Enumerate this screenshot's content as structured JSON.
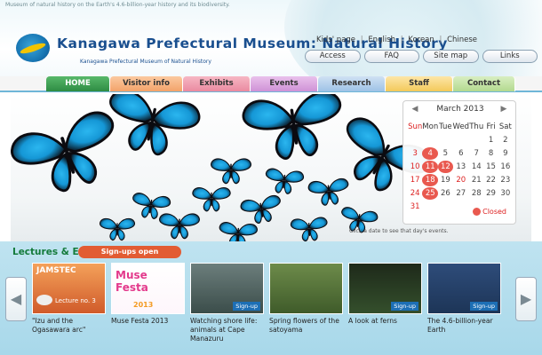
{
  "header": {
    "intro": "Museum of natural history on the Earth's 4.6-billion-year history and its biodiversity.",
    "title": "Kanagawa Prefectural Museum: Natural History",
    "subtitle": "Kanagawa Prefectural Museum of Natural History",
    "top_links": [
      "Kids' page",
      "English",
      "Korean",
      "Chinese"
    ],
    "pills": [
      "Access",
      "FAQ",
      "Site map",
      "Links"
    ]
  },
  "nav": {
    "tabs": [
      "HOME",
      "Visitor info",
      "Exhibits",
      "Events",
      "Research",
      "Staff",
      "Contact"
    ]
  },
  "calendar": {
    "month_label": "March 2013",
    "prev": "◀",
    "next": "▶",
    "weekdays": [
      "Sun",
      "Mon",
      "Tue",
      "Wed",
      "Thu",
      "Fri",
      "Sat"
    ],
    "days": [
      "",
      "",
      "",
      "",
      "",
      "1",
      "2",
      "3",
      "4",
      "5",
      "6",
      "7",
      "8",
      "9",
      "10",
      "11",
      "12",
      "13",
      "14",
      "15",
      "16",
      "17",
      "18",
      "19",
      "20",
      "21",
      "22",
      "23",
      "24",
      "25",
      "26",
      "27",
      "28",
      "29",
      "30",
      "31",
      "",
      "",
      "",
      "",
      "",
      ""
    ],
    "closed_days": [
      "4",
      "11",
      "12",
      "18",
      "25"
    ],
    "legend": "Closed",
    "note": "Click a date to see that day's events."
  },
  "events": {
    "label": "Lectures & Events",
    "badge": "Sign-ups open",
    "arrow_left": "◀",
    "arrow_right": "▶",
    "cards": [
      {
        "thumb_title": "JAMSTEC",
        "thumb_sub": "Lecture no. 3",
        "caption": "\"Izu and the Ogasawara arc\"",
        "stamp": ""
      },
      {
        "thumb_title": "Muse Festa",
        "thumb_sub": "2013",
        "caption": "Muse Festa 2013",
        "stamp": ""
      },
      {
        "thumb_title": "",
        "thumb_sub": "",
        "caption": "Watching shore life: animals at Cape Manazuru",
        "stamp": "Sign-up"
      },
      {
        "thumb_title": "",
        "thumb_sub": "",
        "caption": "Spring flowers of the satoyama",
        "stamp": ""
      },
      {
        "thumb_title": "",
        "thumb_sub": "",
        "caption": "A look at ferns",
        "stamp": "Sign-up"
      },
      {
        "thumb_title": "",
        "thumb_sub": "",
        "caption": "The 4.6-billion-year Earth",
        "stamp": "Sign-up"
      }
    ]
  },
  "colors": {
    "brand_blue": "#1a4f8f",
    "home_green": "#2e8c43",
    "closed_red": "#e9594f",
    "events_bg": "#a8d8ea",
    "badge_orange": "#e25c33",
    "butterfly_blue": "#1597d6"
  }
}
